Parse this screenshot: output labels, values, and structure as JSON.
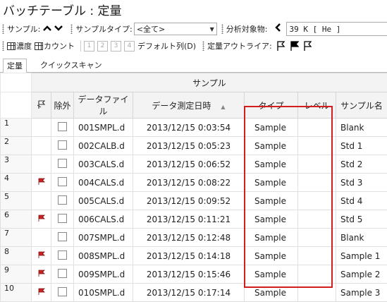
{
  "window": {
    "title": "バッチテーブル : 定量"
  },
  "toolbar1": {
    "sample_label": "サンプル:",
    "sample_type_label": "サンプルタイプ:",
    "sample_type_value": "<全て>",
    "analyte_label": "分析対象物:",
    "analyte_value": "39  K  [ He ]"
  },
  "toolbar2": {
    "concentration_label": "濃度",
    "count_label": "カウント",
    "column_buttons": [
      "1",
      "2",
      "3",
      "4"
    ],
    "default_columns_label": "デフォルト列(D)",
    "outlier_label": "定量アウトライア:"
  },
  "tabs": [
    "定量",
    "クイックスキャン"
  ],
  "grid": {
    "group_header": "サンプル",
    "columns": [
      "除外",
      "データファイル",
      "データ測定日時",
      "タイプ",
      "レベル",
      "サンプル名"
    ],
    "rows": [
      {
        "num": "1",
        "flag": false,
        "file": "001SMPL.d",
        "datetime": "2013/12/15 0:03:54",
        "type": "Sample",
        "level": "",
        "name": "Blank"
      },
      {
        "num": "2",
        "flag": false,
        "file": "002CALB.d",
        "datetime": "2013/12/15 0:05:23",
        "type": "Sample",
        "level": "",
        "name": "Std 1"
      },
      {
        "num": "3",
        "flag": false,
        "file": "003CALS.d",
        "datetime": "2013/12/15 0:06:52",
        "type": "Sample",
        "level": "",
        "name": "Std 2"
      },
      {
        "num": "4",
        "flag": true,
        "file": "004CALS.d",
        "datetime": "2013/12/15 0:08:22",
        "type": "Sample",
        "level": "",
        "name": "Std 3"
      },
      {
        "num": "5",
        "flag": false,
        "file": "005CALS.d",
        "datetime": "2013/12/15 0:09:52",
        "type": "Sample",
        "level": "",
        "name": "Std 4"
      },
      {
        "num": "6",
        "flag": true,
        "file": "006CALS.d",
        "datetime": "2013/12/15 0:11:21",
        "type": "Sample",
        "level": "",
        "name": "Std 5"
      },
      {
        "num": "7",
        "flag": false,
        "file": "007SMPL.d",
        "datetime": "2013/12/15 0:12:48",
        "type": "Sample",
        "level": "",
        "name": "Blank"
      },
      {
        "num": "8",
        "flag": true,
        "file": "008SMPL.d",
        "datetime": "2013/12/15 0:14:18",
        "type": "Sample",
        "level": "",
        "name": "Sample 1"
      },
      {
        "num": "9",
        "flag": true,
        "file": "009SMPL.d",
        "datetime": "2013/12/15 0:15:46",
        "type": "Sample",
        "level": "",
        "name": "Sample 2"
      },
      {
        "num": "10",
        "flag": true,
        "file": "010SMPL.d",
        "datetime": "2013/12/15 0:17:14",
        "type": "Sample",
        "level": "",
        "name": "Sample 3"
      }
    ]
  },
  "colors": {
    "highlight": "#d21e1e",
    "flag_red": "#cc2222"
  },
  "icons": [
    "grip-icon",
    "chevron-up-icon",
    "chevron-down-icon",
    "chevron-left-icon",
    "grid-icon",
    "flag-outline-icon",
    "flag-solid-icon",
    "red-flag-icon"
  ]
}
